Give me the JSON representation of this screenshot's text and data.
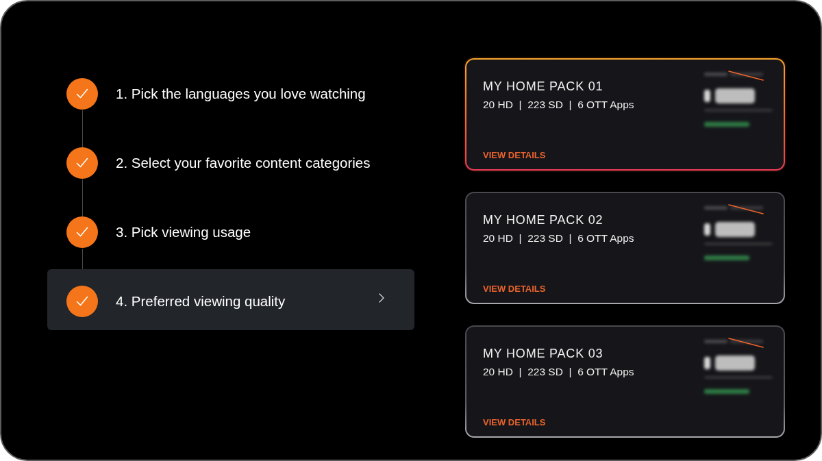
{
  "steps": [
    {
      "label": "1. Pick the languages you love watching",
      "done": true,
      "selected": false
    },
    {
      "label": "2. Select your favorite content categories",
      "done": true,
      "selected": false
    },
    {
      "label": "3. Pick viewing usage",
      "done": true,
      "selected": false
    },
    {
      "label": "4. Preferred viewing quality",
      "done": true,
      "selected": true
    }
  ],
  "packs": [
    {
      "title": "MY HOME PACK 01",
      "features": "20 HD  |  223 SD  |  6 OTT Apps",
      "link": "VIEW DETAILS",
      "selected": true
    },
    {
      "title": "MY HOME PACK 02",
      "features": "20 HD  |  223 SD  |  6 OTT Apps",
      "link": "VIEW DETAILS",
      "selected": false
    },
    {
      "title": "MY HOME PACK 03",
      "features": "20 HD  |  223 SD  |  6 OTT Apps",
      "link": "VIEW DETAILS",
      "selected": false
    }
  ]
}
